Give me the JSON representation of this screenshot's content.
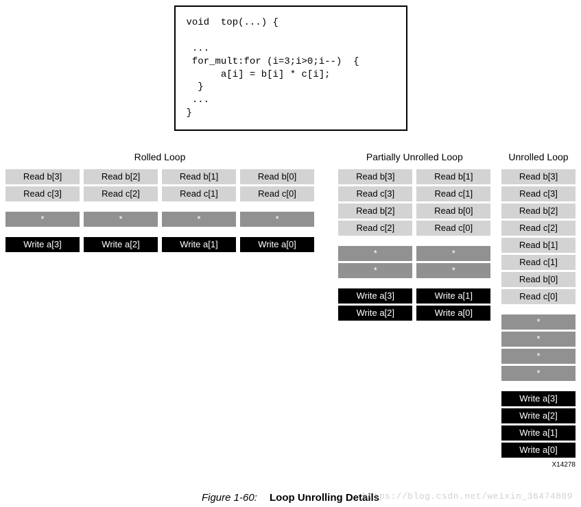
{
  "code": "void  top(...) {\n\n ...\n for_mult:for (i=3;i>0;i--)  {\n      a[i] = b[i] * c[i];\n  }\n ...\n}",
  "titles": {
    "rolled": "Rolled Loop",
    "partial": "Partially Unrolled Loop",
    "unrolled": "Unrolled Loop"
  },
  "rolled_cols": [
    [
      "Read b[3]",
      "Read c[3]",
      "gap",
      "*",
      "gap",
      "Write a[3]"
    ],
    [
      "Read b[2]",
      "Read c[2]",
      "gap",
      "*",
      "gap",
      "Write a[2]"
    ],
    [
      "Read b[1]",
      "Read c[1]",
      "gap",
      "*",
      "gap",
      "Write a[1]"
    ],
    [
      "Read b[0]",
      "Read c[0]",
      "gap",
      "*",
      "gap",
      "Write a[0]"
    ]
  ],
  "partial_cols": [
    [
      "Read b[3]",
      "Read c[3]",
      "Read b[2]",
      "Read c[2]",
      "gap",
      "*",
      "*",
      "gap",
      "Write a[3]",
      "Write a[2]"
    ],
    [
      "Read b[1]",
      "Read c[1]",
      "Read b[0]",
      "Read c[0]",
      "gap",
      "*",
      "*",
      "gap",
      "Write a[1]",
      "Write a[0]"
    ]
  ],
  "unrolled_col": [
    "Read b[3]",
    "Read c[3]",
    "Read b[2]",
    "Read c[2]",
    "Read b[1]",
    "Read c[1]",
    "Read b[0]",
    "Read c[0]",
    "gap",
    "*",
    "*",
    "*",
    "*",
    "gap",
    "Write a[3]",
    "Write a[2]",
    "Write a[1]",
    "Write a[0]"
  ],
  "figure_id": "X14278",
  "caption_label": "Figure 1-60:",
  "caption_title": "Loop Unrolling Details",
  "watermark": "https://blog.csdn.net/weixin_36474809"
}
